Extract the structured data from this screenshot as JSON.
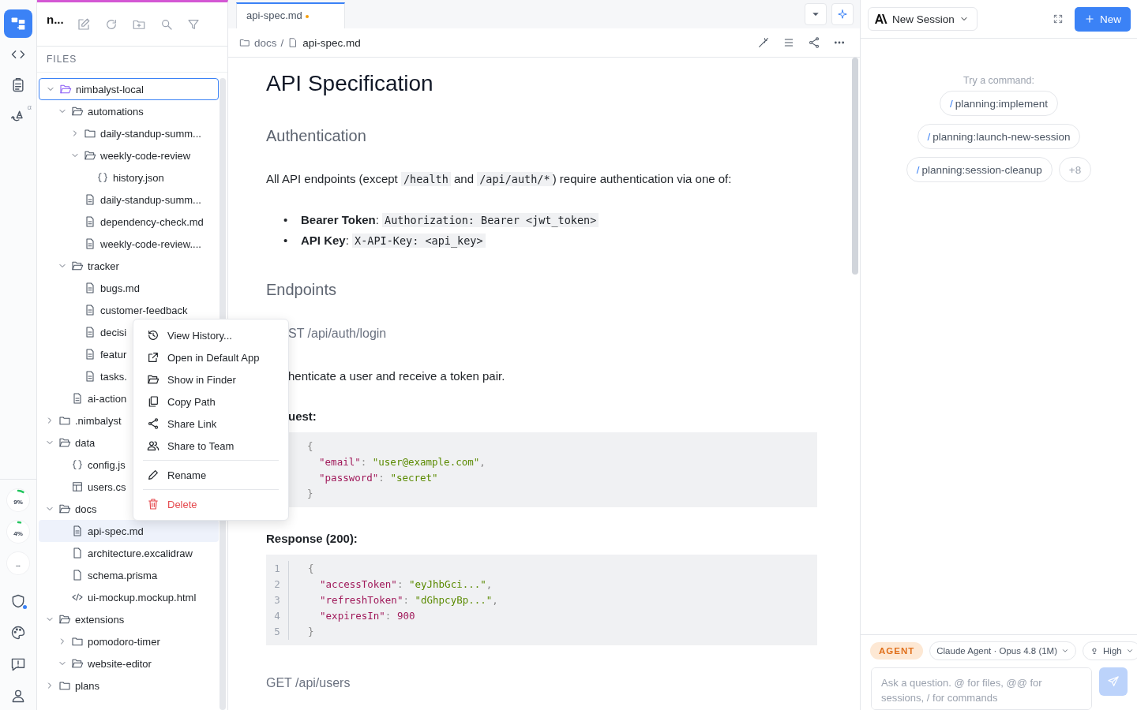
{
  "activity_bar": {
    "items": [
      {
        "kind": "explorer",
        "selected": true
      },
      {
        "kind": "code",
        "selected": false
      },
      {
        "kind": "tasks",
        "selected": false
      },
      {
        "kind": "sync",
        "selected": false,
        "badge": "α"
      }
    ],
    "meters": [
      {
        "reading": "9%",
        "level": 0.09
      },
      {
        "reading": "4%",
        "level": 0.04
      },
      {
        "reading": "--"
      }
    ],
    "bottom": [
      {
        "kind": "shield",
        "notify": true
      },
      {
        "kind": "palette",
        "notify": false
      },
      {
        "kind": "feedback",
        "notify": false
      },
      {
        "kind": "account",
        "notify": false
      }
    ]
  },
  "files": {
    "title": "n...",
    "section": "FILES",
    "tree": [
      {
        "name": "nimbalyst-local",
        "kind": "folder",
        "root": true,
        "expanded": true,
        "selected": false,
        "children": [
          {
            "name": "automations",
            "kind": "folder",
            "expanded": true,
            "selected": false,
            "children": [
              {
                "name": "daily-standup-summ...",
                "kind": "folder",
                "expanded": false,
                "selected": false
              },
              {
                "name": "weekly-code-review",
                "kind": "folder",
                "expanded": true,
                "selected": false,
                "children": [
                  {
                    "name": "history.json",
                    "kind": "json",
                    "selected": false
                  }
                ]
              },
              {
                "name": "daily-standup-summ...",
                "kind": "doc",
                "selected": false
              },
              {
                "name": "dependency-check.md",
                "kind": "doc",
                "selected": false
              },
              {
                "name": "weekly-code-review....",
                "kind": "doc",
                "selected": false
              }
            ]
          },
          {
            "name": "tracker",
            "kind": "folder",
            "expanded": true,
            "selected": false,
            "children": [
              {
                "name": "bugs.md",
                "kind": "doc",
                "selected": false
              },
              {
                "name": "customer-feedback",
                "kind": "doc",
                "selected": false
              },
              {
                "name": "decisi",
                "kind": "doc",
                "selected": false
              },
              {
                "name": "featur",
                "kind": "doc",
                "selected": false
              },
              {
                "name": "tasks.",
                "kind": "doc",
                "selected": false
              }
            ]
          },
          {
            "name": "ai-action",
            "kind": "doc",
            "selected": false
          }
        ]
      },
      {
        "name": ".nimbalyst",
        "kind": "folder",
        "root": false,
        "expanded": false,
        "selected": false
      },
      {
        "name": "data",
        "kind": "folder",
        "root": false,
        "expanded": true,
        "selected": false,
        "children": [
          {
            "name": "config.js",
            "kind": "json",
            "selected": false
          },
          {
            "name": "users.cs",
            "kind": "table",
            "selected": false
          }
        ]
      },
      {
        "name": "docs",
        "kind": "folder",
        "root": false,
        "expanded": true,
        "selected": false,
        "children": [
          {
            "name": "api-spec.md",
            "kind": "doc",
            "selected": true
          },
          {
            "name": "architecture.excalidraw",
            "kind": "blank",
            "selected": false
          },
          {
            "name": "schema.prisma",
            "kind": "blank",
            "selected": false
          },
          {
            "name": "ui-mockup.mockup.html",
            "kind": "html",
            "selected": false
          }
        ]
      },
      {
        "name": "extensions",
        "kind": "folder",
        "root": false,
        "expanded": true,
        "selected": false,
        "children": [
          {
            "name": "pomodoro-timer",
            "kind": "folder",
            "expanded": false,
            "selected": false
          },
          {
            "name": "website-editor",
            "kind": "folder",
            "expanded": true,
            "selected": false
          }
        ]
      },
      {
        "name": "plans",
        "kind": "folder",
        "root": false,
        "expanded": false,
        "selected": false
      }
    ]
  },
  "context_menu": {
    "items": [
      {
        "kind": "history",
        "label": "View History...",
        "danger": false
      },
      {
        "kind": "open",
        "label": "Open in Default App",
        "danger": false
      },
      {
        "kind": "finder",
        "label": "Show in Finder",
        "danger": false
      },
      {
        "kind": "copy",
        "label": "Copy Path",
        "danger": false
      },
      {
        "kind": "share",
        "label": "Share Link",
        "danger": false
      },
      {
        "kind": "team",
        "label": "Share to Team",
        "danger": false
      },
      {
        "kind": "separator"
      },
      {
        "kind": "rename",
        "label": "Rename",
        "danger": false
      },
      {
        "kind": "separator"
      },
      {
        "kind": "delete",
        "label": "Delete",
        "danger": true
      }
    ]
  },
  "editor": {
    "tabs": [
      {
        "label": "api-spec.md",
        "modified": true,
        "selected": true
      }
    ],
    "breadcrumb": {
      "separator": "/",
      "items": [
        "docs",
        "api-spec.md"
      ]
    },
    "doc": [
      {
        "kind": "h1",
        "text": "API Specification"
      },
      {
        "kind": "h2",
        "text": "Authentication"
      },
      {
        "kind": "p",
        "segments": [
          {
            "text": "All API endpoints (except "
          },
          {
            "code": "/health"
          },
          {
            "text": " and "
          },
          {
            "code": "/api/auth/*"
          },
          {
            "text": ") require authentication via one of:"
          }
        ]
      },
      {
        "kind": "list",
        "items": [
          {
            "marker": "•",
            "segments": [
              {
                "text": "**Bearer Token**: "
              },
              {
                "code": "Authorization: Bearer <jwt_token>"
              }
            ]
          },
          {
            "marker": "•",
            "segments": [
              {
                "text": "**API Key**: "
              },
              {
                "code": "X-API-Key: <api_key>"
              }
            ]
          }
        ]
      },
      {
        "kind": "h2",
        "text": "Endpoints"
      },
      {
        "kind": "h3",
        "text": "ST /api/auth/login",
        "clipped": true
      },
      {
        "kind": "p",
        "clipped": true,
        "segments": [
          {
            "text": "henticate a user and receive a token pair."
          }
        ]
      },
      {
        "kind": "label",
        "text": "uest:",
        "clipped": true
      },
      {
        "kind": "code",
        "lines": [
          [
            {
              "kind": "punct",
              "text": "{"
            }
          ],
          [
            {
              "kind": "key",
              "text": "  \"email\""
            },
            {
              "kind": "punct",
              "text": ": "
            },
            {
              "kind": "string",
              "text": "\"user@example.com\""
            },
            {
              "kind": "punct",
              "text": ","
            }
          ],
          [
            {
              "kind": "key",
              "text": "  \"password\""
            },
            {
              "kind": "punct",
              "text": ": "
            },
            {
              "kind": "string",
              "text": "\"secret\""
            }
          ],
          [
            {
              "kind": "punct",
              "text": "}"
            }
          ]
        ]
      },
      {
        "kind": "label",
        "text": "Response (200):"
      },
      {
        "kind": "code",
        "line_numbers": [
          "1",
          "2",
          "3",
          "4",
          "5"
        ],
        "lines": [
          [
            {
              "kind": "punct",
              "text": "{"
            }
          ],
          [
            {
              "kind": "key",
              "text": "  \"accessToken\""
            },
            {
              "kind": "punct",
              "text": ": "
            },
            {
              "kind": "string",
              "text": "\"eyJhbGci...\""
            },
            {
              "kind": "punct",
              "text": ","
            }
          ],
          [
            {
              "kind": "key",
              "text": "  \"refreshToken\""
            },
            {
              "kind": "punct",
              "text": ": "
            },
            {
              "kind": "string",
              "text": "\"dGhpcyBp...\""
            },
            {
              "kind": "punct",
              "text": ","
            }
          ],
          [
            {
              "kind": "key",
              "text": "  \"expiresIn\""
            },
            {
              "kind": "punct",
              "text": ": "
            },
            {
              "kind": "number",
              "text": "900"
            }
          ],
          [
            {
              "kind": "punct",
              "text": "}"
            }
          ]
        ]
      },
      {
        "kind": "h3",
        "text": "GET /api/users"
      }
    ]
  },
  "agent": {
    "session": "New Session",
    "new_button": "New",
    "hint": "Try a command:",
    "commands": [
      {
        "prefix": "/",
        "name": "planning:implement"
      },
      {
        "prefix": "/",
        "name": "planning:launch-new-session"
      },
      {
        "prefix": "/",
        "name": "planning:session-cleanup"
      }
    ],
    "more": "+8",
    "mode": "AGENT",
    "model": "Claude Agent · Opus 4.8 (1M)",
    "effort": "High",
    "input": {
      "placeholder": "Ask a question. @ for files, @@ for sessions, / for commands"
    },
    "send_enabled": false
  }
}
